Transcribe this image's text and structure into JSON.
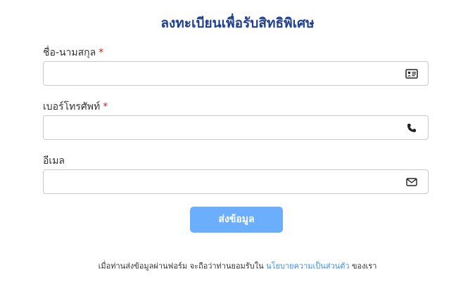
{
  "form": {
    "title": "ลงทะเบียนเพื่อรับสิทธิพิเศษ",
    "fields": [
      {
        "label": "ชื่อ-นามสกุล",
        "required_mark": "*",
        "value": "",
        "icon": "id-card-icon"
      },
      {
        "label": "เบอร์โทรศัพท์",
        "required_mark": "*",
        "value": "",
        "icon": "phone-icon"
      },
      {
        "label": "อีเมล",
        "value": "",
        "icon": "mail-icon"
      }
    ],
    "submit_label": "ส่งข้อมูล",
    "footer": {
      "before": "เมื่อท่านส่งข้อมูลผ่านฟอร์ม จะถือว่าท่านยอมรับใน",
      "link": "นโยบายความเป็นส่วนตัว",
      "after": "ของเรา"
    }
  },
  "colors": {
    "title": "#1f3f8f",
    "required": "#d31f1f",
    "button": "#6aaefc",
    "link": "#3a8ee6"
  }
}
